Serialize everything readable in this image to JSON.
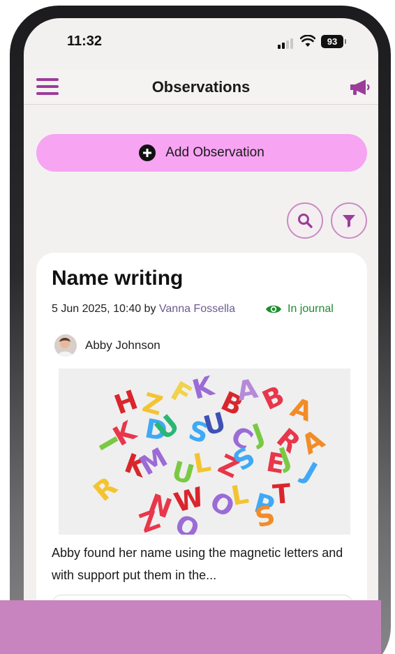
{
  "status_bar": {
    "time": "11:32",
    "battery": "93"
  },
  "nav": {
    "title": "Observations",
    "menu_icon": "hamburger-menu-icon",
    "announcement_icon": "megaphone-icon"
  },
  "actions": {
    "add_observation_label": "Add Observation",
    "search_icon": "search-icon",
    "filter_icon": "filter-icon"
  },
  "observation": {
    "title": "Name writing",
    "meta_prefix": "5 Jun 2025, 10:40 by",
    "author": "Vanna Fossella",
    "journal_status": "In journal",
    "child_name": "Abby Johnson",
    "description": "Abby found her name using the magnetic letters and with support put them in the..."
  },
  "colors": {
    "accent": "#9b3d9a",
    "add_button": "#f7a4f3",
    "journal_green": "#1d8c2c",
    "author_link": "#6b5b8e",
    "overlay": "#c884bf"
  }
}
